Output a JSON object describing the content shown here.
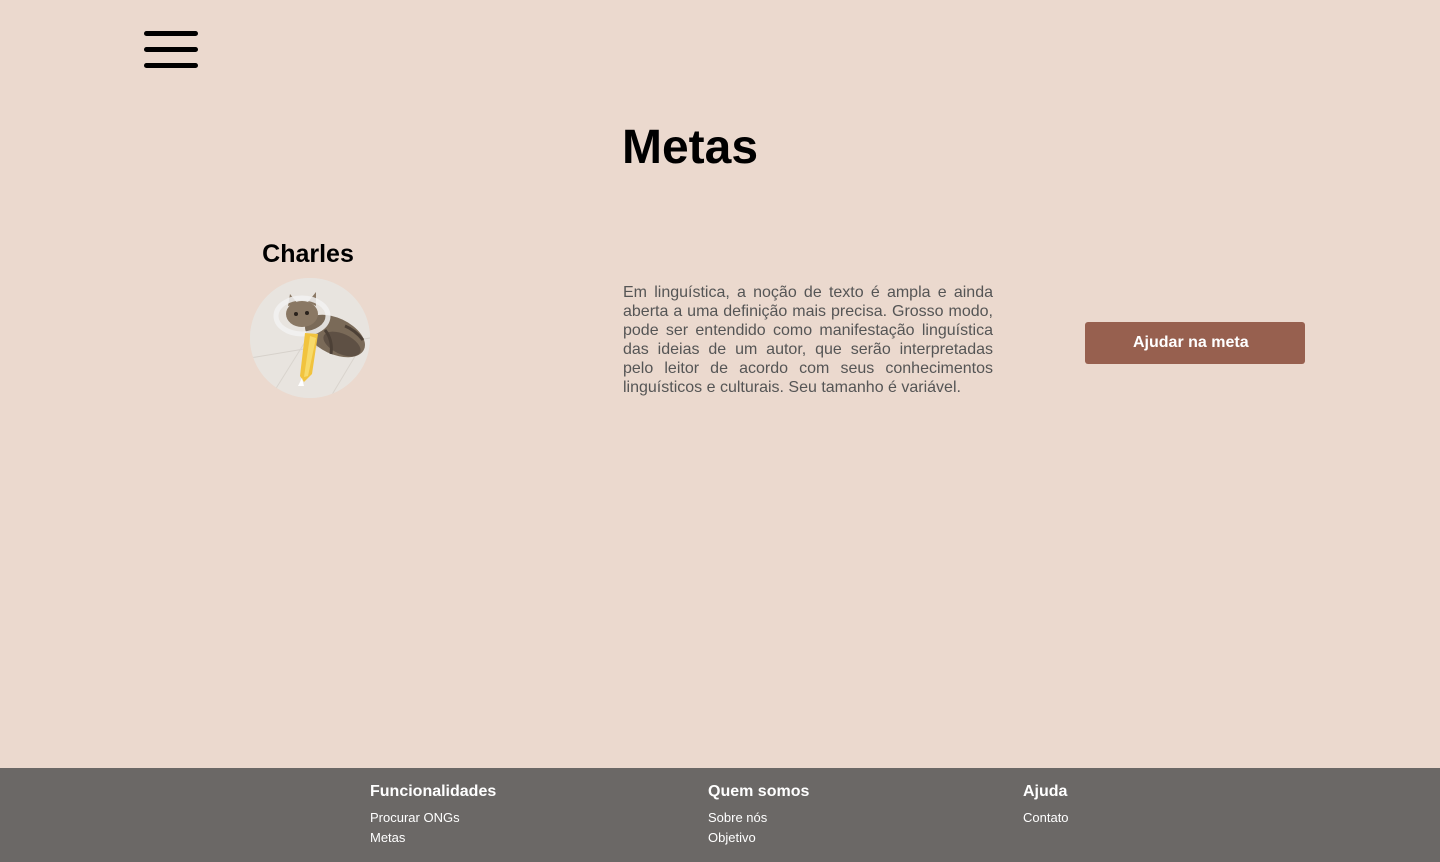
{
  "header": {
    "menu_icon": "hamburger-menu-icon"
  },
  "page": {
    "title": "Metas"
  },
  "goal": {
    "name": "Charles",
    "photo_subject": "cat-photo",
    "description": "Em linguística, a noção de texto é ampla e ainda aberta a uma definição mais precisa. Grosso modo, pode ser entendido como manifestação linguística das ideias de um autor, que serão interpretadas pelo leitor de acordo com seus conhecimentos linguísticos e culturais. Seu tamanho é variável.",
    "button_label": "Ajudar na meta"
  },
  "footer": {
    "columns": [
      {
        "title": "Funcionalidades",
        "links": [
          "Procurar ONGs",
          "Metas"
        ]
      },
      {
        "title": "Quem somos",
        "links": [
          "Sobre nós",
          "Objetivo"
        ]
      },
      {
        "title": "Ajuda",
        "links": [
          "Contato"
        ]
      }
    ]
  },
  "colors": {
    "background": "#EBD9CE",
    "button": "#97604F",
    "footer": "#6B6866",
    "text_body": "#555555"
  }
}
